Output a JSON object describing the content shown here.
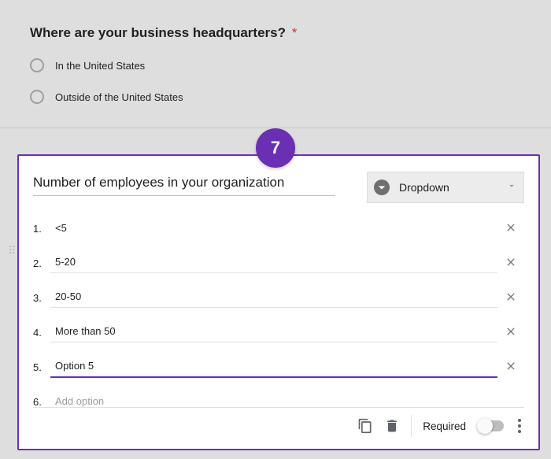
{
  "step_number": "7",
  "prev_question": {
    "title": "Where are your business headquarters?",
    "required_marker": "*",
    "options": [
      "In the United States",
      "Outside of the United States"
    ]
  },
  "card": {
    "question_title": "Number of employees in your organization",
    "type_selector": {
      "label": "Dropdown"
    },
    "options": [
      {
        "num": "1.",
        "text": "<5"
      },
      {
        "num": "2.",
        "text": "5-20"
      },
      {
        "num": "3.",
        "text": "20-50"
      },
      {
        "num": "4.",
        "text": "More than 50"
      },
      {
        "num": "5.",
        "text": "Option 5"
      }
    ],
    "add_row": {
      "num": "6.",
      "placeholder": "Add option"
    },
    "footer": {
      "required_label": "Required"
    }
  }
}
